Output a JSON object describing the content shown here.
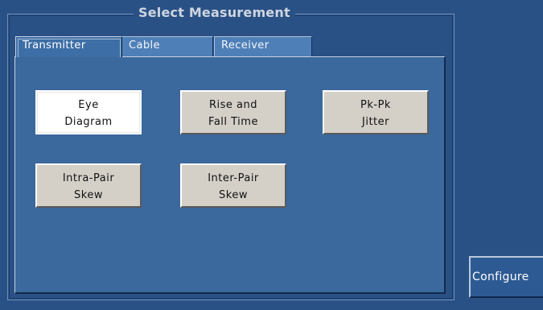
{
  "group": {
    "title": "Select Measurement"
  },
  "tabs": [
    {
      "label": "Transmitter",
      "active": true
    },
    {
      "label": "Cable",
      "active": false
    },
    {
      "label": "Receiver",
      "active": false
    }
  ],
  "measurements": [
    {
      "line1": "Eye",
      "line2": "Diagram",
      "selected": true
    },
    {
      "line1": "Rise and",
      "line2": "Fall Time",
      "selected": false
    },
    {
      "line1": "Pk-Pk",
      "line2": "Jitter",
      "selected": false
    },
    {
      "line1": "Intra-Pair",
      "line2": "Skew",
      "selected": false
    },
    {
      "line1": "Inter-Pair",
      "line2": "Skew",
      "selected": false
    }
  ],
  "configure_label": "Configure",
  "colors": {
    "background": "#2a5186",
    "panel": "#3b689d",
    "button_face": "#d4d0c8",
    "selected_button": "#ffffff"
  }
}
